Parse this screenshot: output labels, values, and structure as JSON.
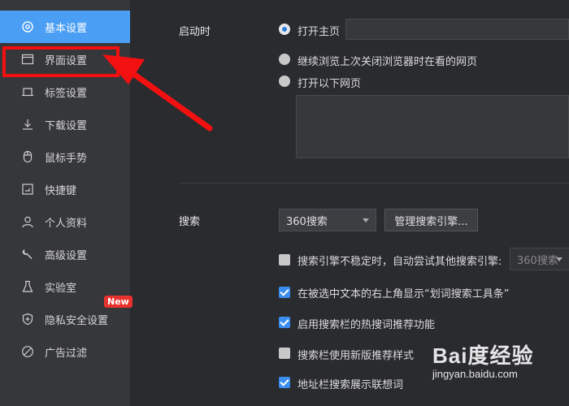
{
  "sidebar": {
    "items": [
      {
        "label": "基本设置",
        "icon": "settings-icon"
      },
      {
        "label": "界面设置",
        "icon": "window-icon"
      },
      {
        "label": "标签设置",
        "icon": "tab-icon"
      },
      {
        "label": "下载设置",
        "icon": "download-icon"
      },
      {
        "label": "鼠标手势",
        "icon": "mouse-icon"
      },
      {
        "label": "快捷键",
        "icon": "keyboard-icon"
      },
      {
        "label": "个人资料",
        "icon": "user-icon"
      },
      {
        "label": "高级设置",
        "icon": "wrench-icon"
      },
      {
        "label": "实验室",
        "icon": "flask-icon"
      },
      {
        "label": "隐私安全设置",
        "icon": "shield-icon"
      },
      {
        "label": "广告过滤",
        "icon": "block-icon"
      }
    ],
    "active_index": 0,
    "new_badge": "New"
  },
  "startup": {
    "label": "启动时",
    "options": [
      {
        "label": "打开主页",
        "checked": true
      },
      {
        "label": "继续浏览上次关闭浏览器时在看的网页",
        "checked": false
      },
      {
        "label": "打开以下网页",
        "checked": false
      }
    ],
    "homepage_value": "",
    "pages_value": ""
  },
  "search": {
    "label": "搜索",
    "engine_selected": "360搜索",
    "manage_button": "管理搜索引擎...",
    "fallback_engine": "360搜索",
    "options": [
      {
        "label": "搜索引擎不稳定时，自动尝试其他搜索引擎:",
        "checked": false
      },
      {
        "label": "在被选中文本的右上角显示“划词搜索工具条”",
        "checked": true
      },
      {
        "label": "启用搜索栏的热搜词推荐功能",
        "checked": true
      },
      {
        "label": "搜索栏使用新版推荐样式",
        "checked": false
      },
      {
        "label": "地址栏搜索展示联想词",
        "checked": true
      }
    ]
  },
  "watermark": {
    "logo": "Bai度经验",
    "url": "jingyan.baidu.com"
  },
  "colors": {
    "accent": "#4a9ef4",
    "highlight": "#f21010",
    "badge": "#e8322e",
    "sidebar_bg": "#36373b",
    "main_bg": "#2a2b2f"
  }
}
